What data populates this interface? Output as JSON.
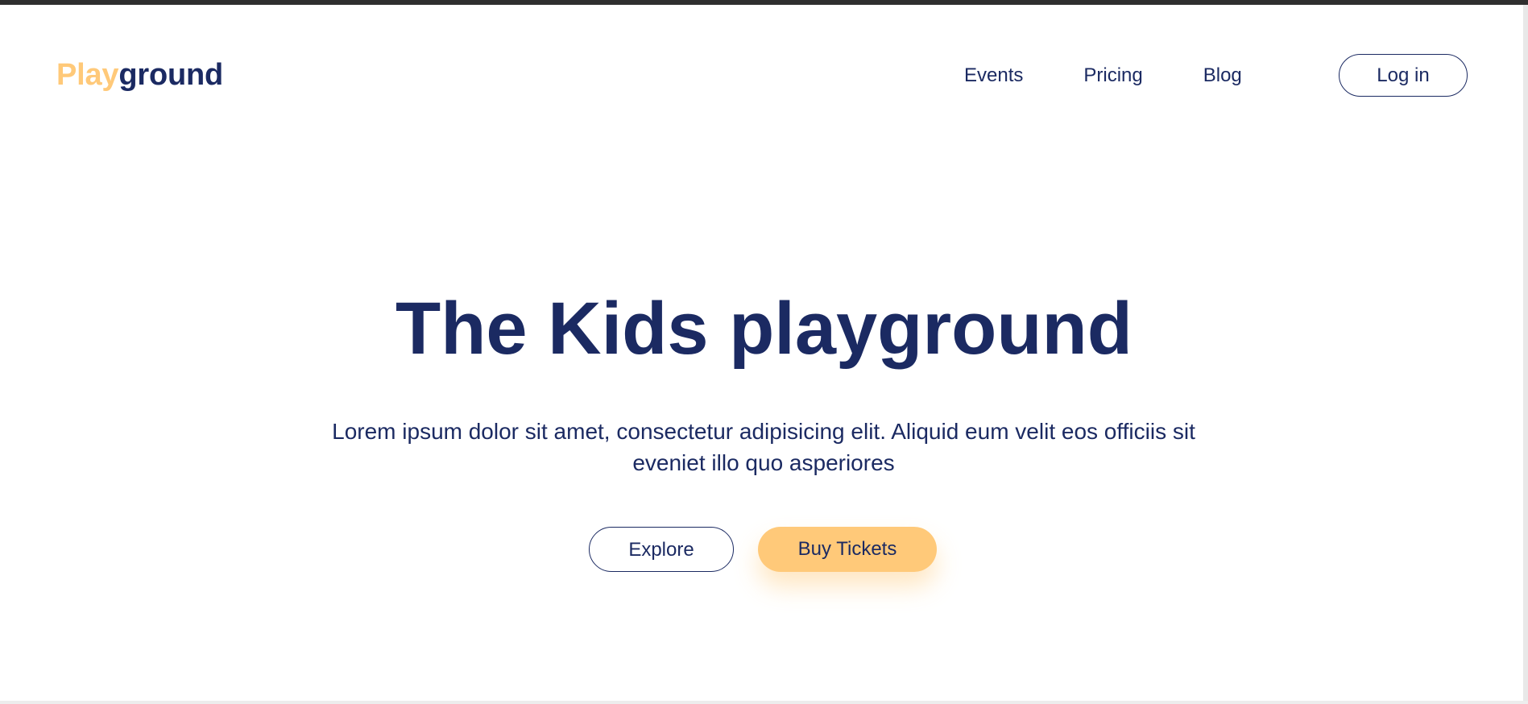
{
  "brand": {
    "logo_part1": "Play",
    "logo_part2": "ground",
    "accent_color": "#ffc979",
    "primary_color": "#1b2a62"
  },
  "nav": {
    "items": [
      {
        "label": "Events"
      },
      {
        "label": "Pricing"
      },
      {
        "label": "Blog"
      }
    ],
    "login_label": "Log in"
  },
  "hero": {
    "title": "The Kids playground",
    "text": "Lorem ipsum dolor sit amet, consectetur adipisicing elit. Aliquid eum velit eos officiis sit eveniet illo quo asperiores",
    "explore_label": "Explore",
    "buy_label": "Buy Tickets"
  }
}
